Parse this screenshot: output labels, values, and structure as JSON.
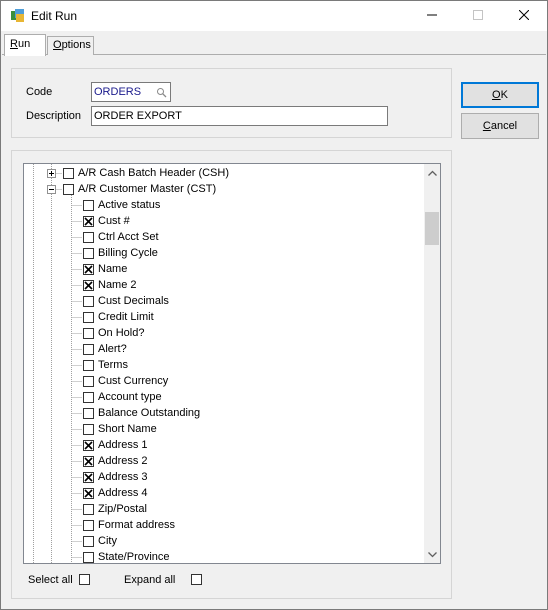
{
  "window": {
    "title": "Edit Run"
  },
  "tabs": [
    {
      "label": "Run",
      "underline_char": "R",
      "rest": "un",
      "selected": true
    },
    {
      "label": "Options",
      "underline_char": "O",
      "rest": "ptions",
      "selected": false
    }
  ],
  "form": {
    "code_label": "Code",
    "code_value": "ORDERS",
    "description_label": "Description",
    "description_value": "ORDER EXPORT"
  },
  "buttons": {
    "ok": {
      "underline_char": "O",
      "rest": "K"
    },
    "cancel": {
      "underline_char": "C",
      "rest": "ancel"
    }
  },
  "tree": {
    "groups": [
      {
        "label": "A/R Cash Batch Header (CSH)",
        "expanded": false,
        "checked": false
      },
      {
        "label": "A/R Customer Master (CST)",
        "expanded": true,
        "checked": false
      }
    ],
    "fields": [
      {
        "label": "Active status",
        "checked": false
      },
      {
        "label": "Cust #",
        "checked": true
      },
      {
        "label": "Ctrl Acct Set",
        "checked": false
      },
      {
        "label": "Billing Cycle",
        "checked": false
      },
      {
        "label": "Name",
        "checked": true
      },
      {
        "label": "Name 2",
        "checked": true
      },
      {
        "label": "Cust Decimals",
        "checked": false
      },
      {
        "label": "Credit Limit",
        "checked": false
      },
      {
        "label": "On Hold?",
        "checked": false
      },
      {
        "label": "Alert?",
        "checked": false
      },
      {
        "label": "Terms",
        "checked": false
      },
      {
        "label": "Cust Currency",
        "checked": false
      },
      {
        "label": "Account type",
        "checked": false
      },
      {
        "label": "Balance Outstanding",
        "checked": false
      },
      {
        "label": "Short Name",
        "checked": false
      },
      {
        "label": "Address 1",
        "checked": true
      },
      {
        "label": "Address 2",
        "checked": true
      },
      {
        "label": "Address 3",
        "checked": true
      },
      {
        "label": "Address 4",
        "checked": true
      },
      {
        "label": "Zip/Postal",
        "checked": false
      },
      {
        "label": "Format address",
        "checked": false
      },
      {
        "label": "City",
        "checked": false
      },
      {
        "label": "State/Province",
        "checked": false
      }
    ]
  },
  "options": {
    "select_all_label": "Select all",
    "select_all_checked": false,
    "expand_all_label": "Expand all",
    "expand_all_checked": false
  },
  "colors": {
    "accent": "#0078d7",
    "code_text": "#1a1a8c",
    "window_bg": "#f0f0f0"
  }
}
